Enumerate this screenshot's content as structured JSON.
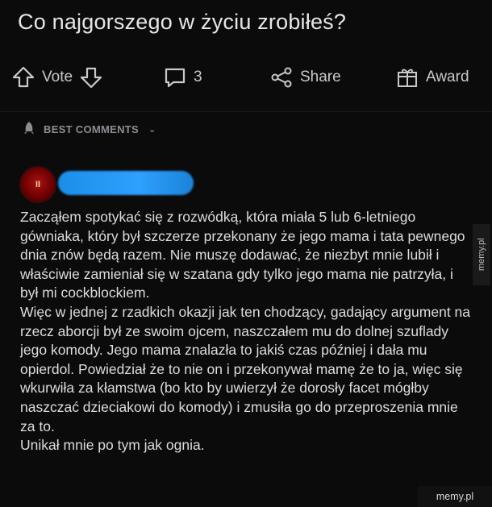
{
  "post": {
    "title": "Co najgorszego w życiu zrobiłeś?"
  },
  "actions": {
    "vote_label": "Vote",
    "comment_count": "3",
    "share_label": "Share",
    "award_label": "Award",
    "icons": [
      "arrow-up-icon",
      "arrow-down-icon",
      "comment-icon",
      "share-icon",
      "gift-icon"
    ]
  },
  "sort": {
    "label": "BEST COMMENTS"
  },
  "comment": {
    "body": [
      "Zacząłem spotykać się z rozwódką, która miała 5 lub 6-letniego gówniaka, który był szczerze przekonany że jego mama i tata pewnego dnia znów będą razem. Nie muszę dodawać, że niezbyt mnie lubił i właściwie zamieniał się w szatana gdy tylko jego mama nie patrzyła, i był mi cockblockiem.",
      "Więc w jednej z rzadkich okazji jak ten chodzący, gadający argument na rzecz aborcji był ze swoim ojcem, naszczałem mu do dolnej szuflady jego komody. Jego mama znalazła to jakiś czas później i dała mu opierdol. Powiedział że to nie on i przekonywał mamę że to ja, więc się wkurwiła za kłamstwa (bo kto by uwierzył że dorosły facet mógłby naszczać dzieciakowi do komody) i zmusiła go do przeproszenia mnie za to.",
      "Unikał mnie po tym jak ognia."
    ]
  },
  "watermarks": {
    "side": "memy.pl",
    "corner": "memy.pl"
  },
  "colors": {
    "background": "#0b0b0c",
    "text": "#dcdcdc",
    "muted": "#8b8e92",
    "username_redaction": "#2ea0ff"
  }
}
